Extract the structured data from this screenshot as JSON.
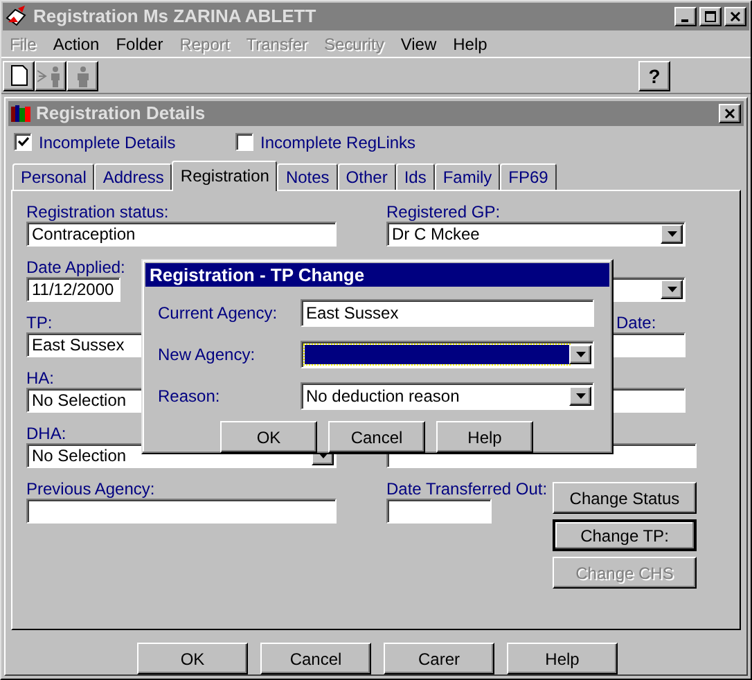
{
  "window": {
    "title": "Registration Ms ZARINA ABLETT"
  },
  "menu": [
    {
      "label": "File",
      "disabled": true
    },
    {
      "label": "Action",
      "disabled": false
    },
    {
      "label": "Folder",
      "disabled": false
    },
    {
      "label": "Report",
      "disabled": true
    },
    {
      "label": "Transfer",
      "disabled": true
    },
    {
      "label": "Security",
      "disabled": true
    },
    {
      "label": "View",
      "disabled": false
    },
    {
      "label": "Help",
      "disabled": false
    }
  ],
  "toolbar": [
    {
      "kind": "document",
      "disabled": false
    },
    {
      "kind": "person-arrow",
      "disabled": true
    },
    {
      "kind": "person",
      "disabled": true
    }
  ],
  "help_button": {
    "label": "?"
  },
  "details": {
    "title": "Registration Details",
    "flags": [
      {
        "label": "Incomplete Details",
        "checked": true
      },
      {
        "label": "Incomplete RegLinks",
        "checked": false
      }
    ],
    "tabs": [
      {
        "label": "Personal",
        "selected": false
      },
      {
        "label": "Address",
        "selected": false
      },
      {
        "label": "Registration",
        "selected": true
      },
      {
        "label": "Notes",
        "selected": false
      },
      {
        "label": "Other",
        "selected": false
      },
      {
        "label": "Ids",
        "selected": false
      },
      {
        "label": "Family",
        "selected": false
      },
      {
        "label": "FP69",
        "selected": false
      }
    ],
    "left_fields": [
      {
        "kind": "text",
        "label": "Registration status:",
        "value": "Contraception"
      },
      {
        "kind": "short",
        "label": "Date Applied:",
        "value": "11/12/2000"
      },
      {
        "kind": "text",
        "label": "TP:",
        "value": "East Sussex"
      },
      {
        "kind": "text",
        "label": "HA:",
        "value": "No Selection"
      },
      {
        "kind": "combo",
        "label": "DHA:",
        "value": "No Selection"
      },
      {
        "kind": "text",
        "label": "Previous Agency:"
      }
    ],
    "right_fields": [
      {
        "kind": "combo",
        "label": "Registered GP:",
        "value": "Dr C Mckee"
      },
      {
        "kind": "combo"
      },
      {
        "kind": "text",
        "label_tail": "Date:"
      },
      {
        "kind": "text"
      },
      {
        "kind": "wide"
      }
    ],
    "transferred_out": {
      "label": "Date Transferred Out:"
    },
    "actions": [
      {
        "label": "Change Status",
        "disabled": false,
        "default": false
      },
      {
        "label": "Change TP:",
        "disabled": false,
        "default": true
      },
      {
        "label": "Change CHS",
        "disabled": true,
        "default": false
      }
    ],
    "buttons": [
      "OK",
      "Cancel",
      "Carer",
      "Help"
    ]
  },
  "dialog": {
    "title": "Registration - TP Change",
    "fields": [
      {
        "kind": "text",
        "label": "Current Agency:",
        "value": "East Sussex",
        "focused": false
      },
      {
        "kind": "combo",
        "label": "New Agency:",
        "focused": true
      },
      {
        "kind": "combo",
        "label": "Reason:",
        "value": "No deduction reason",
        "focused": false
      }
    ],
    "buttons": [
      "OK",
      "Cancel",
      "Help"
    ]
  }
}
